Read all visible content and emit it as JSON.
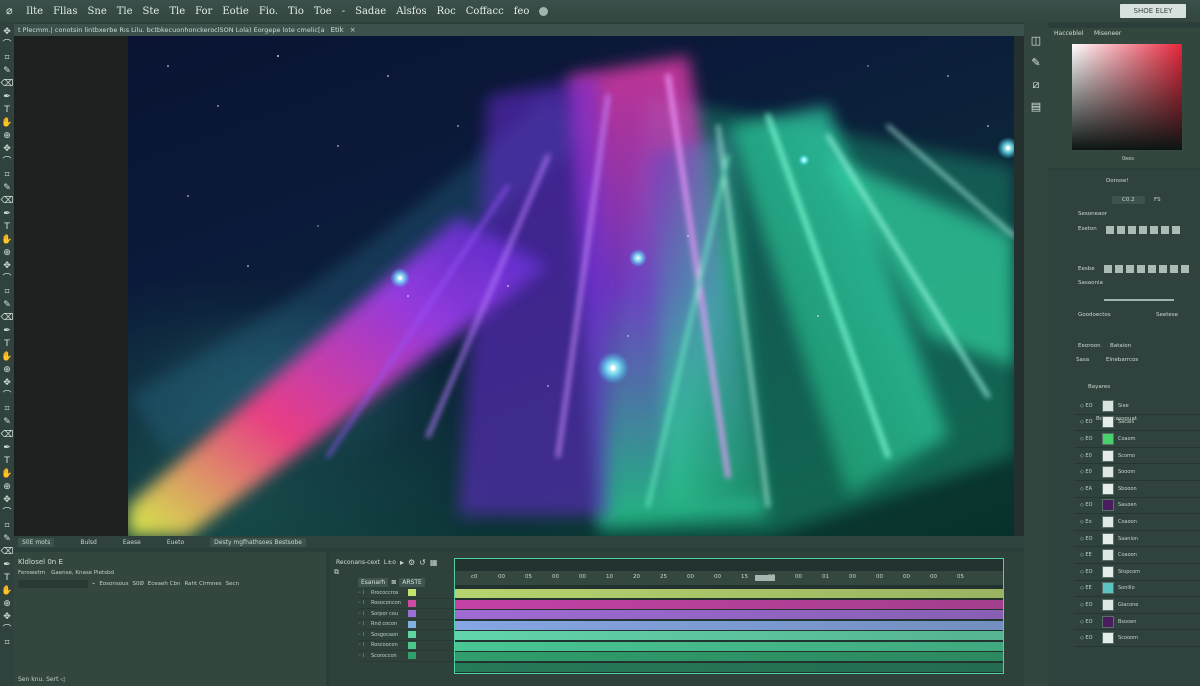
{
  "menubar": {
    "items": [
      "Ilte",
      "Fllas",
      "Sne",
      "Tle",
      "Ste",
      "Tle",
      "For",
      "Eotie",
      "Fio.",
      "Tio",
      "Toe",
      "-",
      "Sadae",
      "Alsfos",
      "Roc",
      "Coffacc",
      "feo"
    ],
    "search_label": "SHOE ELEY"
  },
  "tab": {
    "title": "t Plecmm.| conotsin lintbxerbe Rıs Lilu. bctbkecuonhonckeroclSON Lola) Eorgepe lote cmelic[a",
    "zoom": "Etik",
    "close": "×"
  },
  "toolbar": {
    "tools": [
      "move",
      "lasso",
      "crop",
      "brush",
      "eraser",
      "pen",
      "type",
      "hand",
      "zoom"
    ]
  },
  "status": {
    "zoom": "S0E mots",
    "mode": "Bulsd",
    "item3": "Eaese",
    "item4": "Eueto",
    "info": "Desty mgfhathsoes Bestsobe"
  },
  "properties": {
    "title": "Kldlosel  0n  E",
    "row1": [
      "Ferowetm",
      "Gaense, Knase Pietsbd"
    ],
    "row2": [
      "Eosonsous",
      "S0Ø",
      "Eceaeh Cbn",
      "Raht Clrmnes",
      "Secn"
    ],
    "footer": "Sen  knu. Sert  ◁"
  },
  "timeline": {
    "panel_label": "Reconans-cext",
    "title": "L±o",
    "head_label": "Esanarh",
    "head_button": "ARSTE",
    "ruler": [
      "c0",
      "00",
      "05",
      "00",
      "00",
      "10",
      "20",
      "25",
      "00",
      "00",
      "15",
      "20",
      "00",
      "01",
      "00",
      "00",
      "00",
      "00",
      "05"
    ],
    "layers": [
      {
        "name": "Rrococcros",
        "color": "#c4e26e"
      },
      {
        "name": "Rosoconcon",
        "color": "#d14aa1"
      },
      {
        "name": "Sorpor cou",
        "color": "#9a6fd6"
      },
      {
        "name": "Rnd cocon",
        "color": "#7eb0e0"
      },
      {
        "name": "Sosgocaon",
        "color": "#5fd6a2"
      },
      {
        "name": "Roscoocon",
        "color": "#4cc98a"
      },
      {
        "name": "Scoroccon",
        "color": "#2fa06c"
      }
    ],
    "track_colors": [
      "#b7d36e",
      "#c341a4",
      "#a06ad4",
      "#86a6e4",
      "#62d4ab",
      "#48c693",
      "#2f9e6c",
      "#257a58"
    ]
  },
  "color_panel": {
    "label": "Hacceblel",
    "label2": "Miseneer",
    "hint": "0ees"
  },
  "right": {
    "p1": "Donsse!",
    "p2": "C0.2",
    "p3": "FS",
    "p4": "Sesoneaor",
    "p5": "Eseton",
    "p6": "Eesbe",
    "p7": "Sasaonia",
    "p8": "Goodoectos",
    "p9": "Seetese",
    "p10": "Eeoroon",
    "p11": "Bataion",
    "p12": "Sasa",
    "p13": "Elnebarrcos",
    "p14": "Bayares",
    "layers_title": "Bocaccassouat"
  },
  "layers": [
    {
      "vis": "◇ EO",
      "name": "Siee",
      "thumb": "#d9e3e0"
    },
    {
      "vis": "◇ EO",
      "name": "Sacais",
      "thumb": "#e6eeeb"
    },
    {
      "vis": "◇ EO",
      "name": "Coaom",
      "thumb": "#4ad16e"
    },
    {
      "vis": "◇ E0",
      "name": "Scomo",
      "thumb": "#e3ecea"
    },
    {
      "vis": "◇ E0",
      "name": "Sooom",
      "thumb": "#dde7e4"
    },
    {
      "vis": "◇ EA",
      "name": "Sbooon",
      "thumb": "#e6eeeb"
    },
    {
      "vis": "◇ EO",
      "name": "Sauoen",
      "thumb": "#4a1e5e"
    },
    {
      "vis": "◇ Eo",
      "name": "Coaoon",
      "thumb": "#e0e9e6"
    },
    {
      "vis": "◇ EO",
      "name": "Saanion",
      "thumb": "#e6eeeb"
    },
    {
      "vis": "◇ EE",
      "name": "Coaoon",
      "thumb": "#dde7e4"
    },
    {
      "vis": "◇ EO",
      "name": "Stopcom",
      "thumb": "#e6eeeb"
    },
    {
      "vis": "◇ EE",
      "name": "Sonillo",
      "thumb": "#5cc4c0"
    },
    {
      "vis": "◇ EO",
      "name": "Giacone",
      "thumb": "#dde7e4"
    },
    {
      "vis": "◇ EO",
      "name": "Bsooen",
      "thumb": "#4a1e5e"
    },
    {
      "vis": "◇ EO",
      "name": "Scooom",
      "thumb": "#e6eeeb"
    }
  ],
  "dock": {
    "icons": [
      "history-icon",
      "brush-settings-icon",
      "adjust-icon",
      "book-icon"
    ]
  }
}
